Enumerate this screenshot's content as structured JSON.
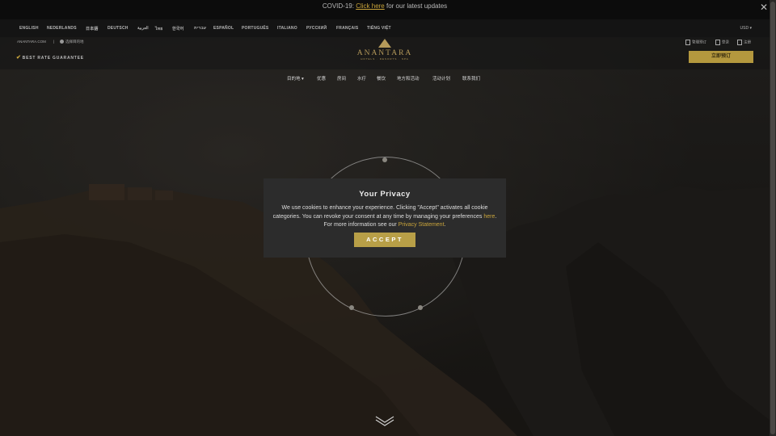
{
  "covid_bar": {
    "prefix": "COVID-19:",
    "link": "Click here",
    "suffix": "for our latest updates",
    "close_glyph": "✕"
  },
  "languages": [
    "ENGLISH",
    "NEDERLANDS",
    "日本語",
    "DEUTSCH",
    "العربية",
    "ไทย",
    "한국어",
    "עברית",
    "ESPAÑOL",
    "PORTUGUÊS",
    "ITALIANO",
    "РУССКИЙ",
    "FRANÇAIS",
    "TIẾNG VIỆT"
  ],
  "currency": "USD ▾",
  "utility": {
    "site_link": "ANANTARA.COM",
    "separator": "|",
    "globe_label": "选择目的地",
    "best_rate": "BEST RATE GUARANTEE",
    "right_links": [
      "管理预订",
      "登录",
      "注册"
    ],
    "book_button": "立即预订"
  },
  "logo": {
    "name": "ANANTARA",
    "subtitle": "HOTELS · RESORTS · SPA"
  },
  "nav": [
    "目的地",
    "优惠",
    "房间",
    "水疗",
    "餐饮",
    "地方和活动",
    "活动计划",
    "联系我们"
  ],
  "privacy": {
    "title": "Your Privacy",
    "text1": "We use cookies to enhance your experience. Clicking \"Accept\" activates all cookie categories. You can revoke your consent at any time by managing your preferences",
    "here": "here",
    "text2": ". For more information see our",
    "statement": "Privacy Statement",
    "text3": ".",
    "accept": "ACCEPT"
  },
  "colors": {
    "accent_gold": "#c9a43b",
    "button_gold": "#b89f47",
    "modal_bg": "#2c2c2c"
  }
}
